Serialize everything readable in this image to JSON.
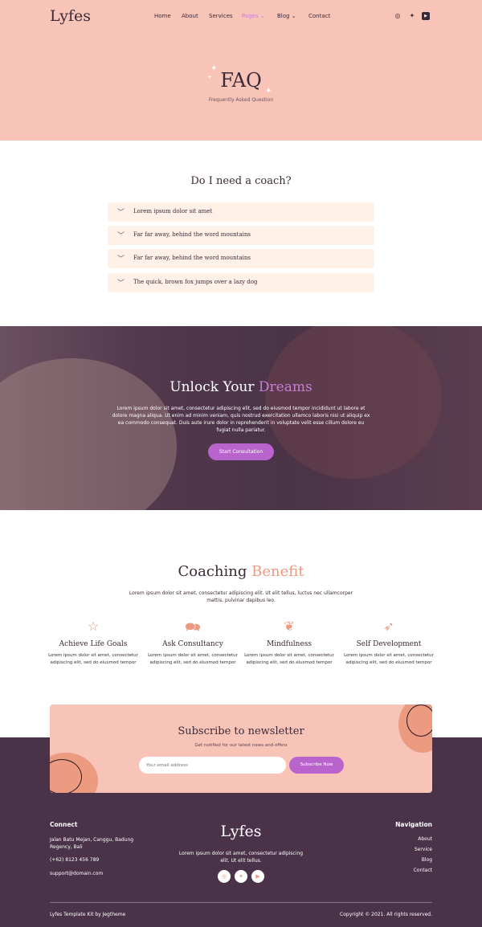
{
  "colors": {
    "pink": "#f8c4b8",
    "plum": "#4a3249",
    "accent_purple": "#b964cc",
    "accent_coral": "#ec9a80",
    "cream": "#fdf1e8"
  },
  "header": {
    "logo": "Lyfes",
    "nav": [
      "Home",
      "About",
      "Services",
      "Pages",
      "Blog",
      "Contact"
    ],
    "active": "Pages",
    "social": [
      "instagram-icon",
      "twitter-icon",
      "youtube-icon"
    ]
  },
  "page_title": {
    "title": "FAQ",
    "subtitle": "Frequently Asked Question"
  },
  "faq": {
    "heading": "Do I need a coach?",
    "items": [
      "Lorem ipsum dolor sit amet",
      "Far far away, behind the word mountains",
      "Far far away, behind the word mountains",
      "The quick, brown fox jumps over a lazy dog"
    ]
  },
  "hero": {
    "title_a": "Unlock Your",
    "title_b": "Dreams",
    "text": "Lorem ipsum dolor sit amet, consectetur adipiscing elit, sed do eiusmod tempor incididunt ut labore et dolore magna aliqua. Ut enim ad minim veniam, quis nostrud exercitation ullamco laboris nisi ut aliquip ex ea commodo consequat. Duis aute irure dolor in reprehenderit in voluptate velit esse cillum dolore eu fugiat nulla pariatur.",
    "button": "Start Consultation"
  },
  "benefit": {
    "title_a": "Coaching",
    "title_b": "Benefit",
    "text": "Lorem ipsum dolor sit amet, consectetur adipiscing elit. Ut elit tellus, luctus nec ullamcorper mattis, pulvinar dapibus leo.",
    "items": [
      {
        "icon": "star-icon",
        "title": "Achieve Life Goals",
        "text": "Lorem ipsum dolor sit amet, consectetur adipiscing elit, sed do eiusmod tempor"
      },
      {
        "icon": "chat-icon",
        "title": "Ask Consultancy",
        "text": "Lorem ipsum dolor sit amet, consectetur adipiscing elit, sed do eiusmod tempor"
      },
      {
        "icon": "leaf-icon",
        "title": "Mindfulness",
        "text": "Lorem ipsum dolor sit amet, consectetur adipiscing elit, sed do eiusmod tempor"
      },
      {
        "icon": "rocket-icon",
        "title": "Self Development",
        "text": "Lorem ipsum dolor sit amet, consectetur adipiscing elit, sed do eiusmod tempor"
      }
    ]
  },
  "newsletter": {
    "title": "Subscribe to newsletter",
    "subtitle": "Get notified for our latest news and offers",
    "placeholder": "Your email address",
    "button": "Subscribe Now"
  },
  "footer": {
    "connect_heading": "Connect",
    "address": "Jalan Batu Mejan, Canggu, Badung Regency, Bali",
    "phone": "(+62) 8123 456 789",
    "email": "support@domain.com",
    "logo": "Lyfes",
    "about": "Lorem ipsum dolor sit amet, consectetur adipiscing elit. Ut elit tellus.",
    "nav_heading": "Navigation",
    "nav": [
      "About",
      "Service",
      "Blog",
      "Contact"
    ],
    "credit": "Lyfes Template Kit by Jegtheme",
    "copyright": "Copyright © 2021. All rights reserved."
  }
}
